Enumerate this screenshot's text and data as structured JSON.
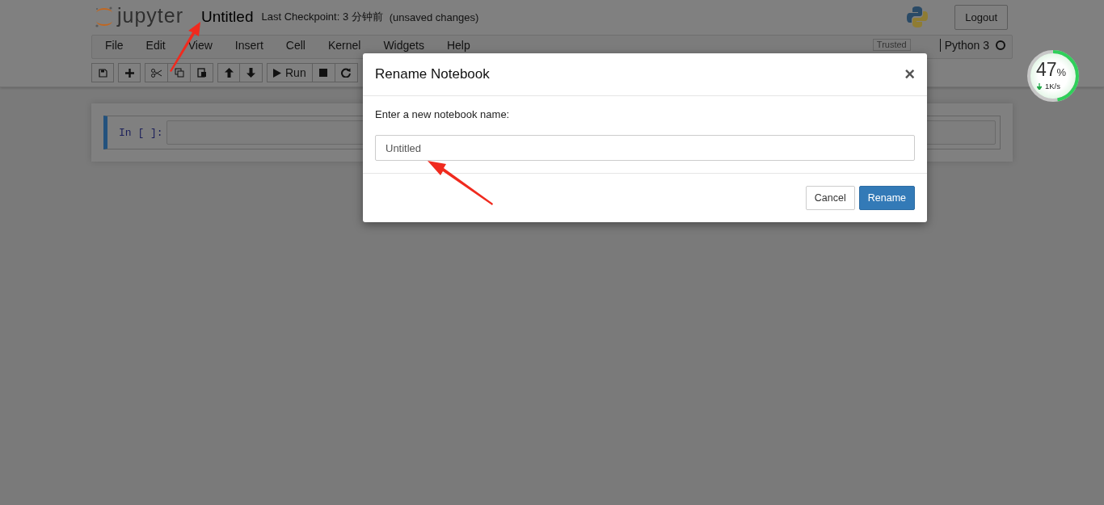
{
  "header": {
    "logo_text": "jupyter",
    "notebook_title": "Untitled",
    "checkpoint": "Last Checkpoint: 3 分钟前",
    "autosave_status": "(unsaved changes)",
    "logout": "Logout"
  },
  "menu": [
    "File",
    "Edit",
    "View",
    "Insert",
    "Cell",
    "Kernel",
    "Widgets",
    "Help"
  ],
  "trusted": "Trusted",
  "kernel": {
    "name": "Python 3",
    "busy": false
  },
  "toolbar": [
    {
      "kind": "save"
    },
    {
      "kind": "add"
    },
    {
      "kind": "cut"
    },
    {
      "kind": "copy"
    },
    {
      "kind": "paste"
    },
    {
      "kind": "up"
    },
    {
      "kind": "down"
    },
    {
      "kind": "run",
      "label": "Run"
    },
    {
      "kind": "stop"
    },
    {
      "kind": "restart"
    }
  ],
  "cell": {
    "prompt": "In [ ]:",
    "selected": true
  },
  "speed_widget": {
    "percent": "47",
    "unit": "%",
    "rate": "1K/s",
    "level": 0.47
  },
  "dialog": {
    "title": "Rename Notebook",
    "close": "×",
    "prompt": "Enter a new notebook name:",
    "value": "Untitled",
    "cancel": "Cancel",
    "confirm": "Rename"
  }
}
